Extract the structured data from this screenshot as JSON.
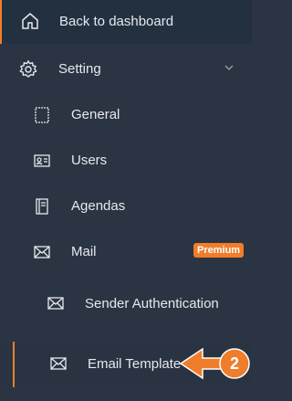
{
  "sidebar": {
    "back": {
      "label": "Back to dashboard",
      "icon": "home-icon"
    },
    "setting": {
      "label": "Setting",
      "icon": "gear-icon",
      "expand_icon": "chevron-down-icon"
    },
    "items": [
      {
        "label": "General",
        "icon": "square-outline-icon"
      },
      {
        "label": "Users",
        "icon": "id-card-icon"
      },
      {
        "label": "Agendas",
        "icon": "notebook-icon"
      },
      {
        "label": "Mail",
        "icon": "envelope-icon",
        "badge": "Premium"
      }
    ],
    "mail_items": [
      {
        "label": "Sender Authentication",
        "icon": "envelope-icon"
      },
      {
        "label": "Email Template",
        "icon": "envelope-icon"
      }
    ]
  },
  "annotation": {
    "step_number": "2"
  },
  "colors": {
    "accent": "#f07d2a",
    "sidebar_bg": "#2b3442",
    "text": "#e6e9ee"
  }
}
